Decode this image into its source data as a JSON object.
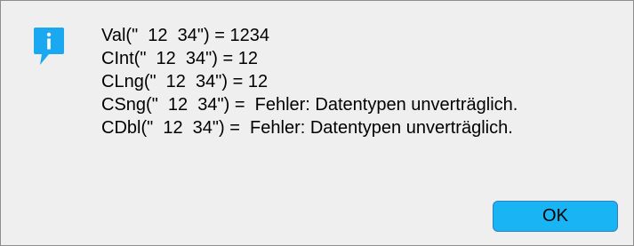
{
  "dialog": {
    "icon": "info-icon",
    "accent_color": "#1aa8f0",
    "lines": [
      "Val(\"  12  34\") = 1234",
      "CInt(\"  12  34\") = 12",
      "CLng(\"  12  34\") = 12",
      "CSng(\"  12  34\") =  Fehler: Datentypen unverträglich.",
      "CDbl(\"  12  34\") =  Fehler: Datentypen unverträglich."
    ],
    "ok_label": "OK"
  }
}
